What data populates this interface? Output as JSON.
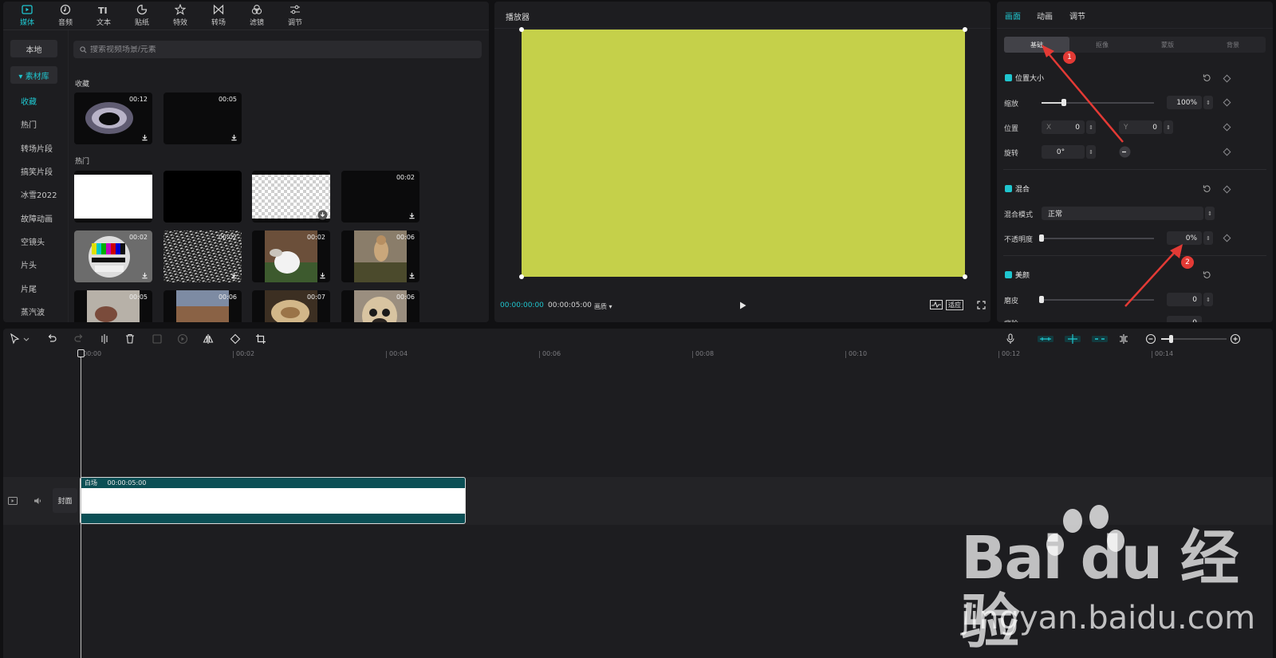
{
  "media_panel": {
    "tabs": [
      {
        "label": "媒体",
        "icon": "media-icon"
      },
      {
        "label": "音频",
        "icon": "audio-icon"
      },
      {
        "label": "文本",
        "icon": "text-icon"
      },
      {
        "label": "贴纸",
        "icon": "sticker-icon"
      },
      {
        "label": "特效",
        "icon": "effects-icon"
      },
      {
        "label": "转场",
        "icon": "transition-icon"
      },
      {
        "label": "滤镜",
        "icon": "filter-icon"
      },
      {
        "label": "调节",
        "icon": "adjust-icon"
      }
    ],
    "sidebar": {
      "local": "本地",
      "library": "▾ 素材库",
      "items": [
        "收藏",
        "热门",
        "转场片段",
        "搞笑片段",
        "冰雪2022",
        "故障动画",
        "空镜头",
        "片头",
        "片尾",
        "蒸汽波"
      ]
    },
    "search_placeholder": "搜索视频场景/元素",
    "sections": {
      "favorites": "收藏",
      "hot": "热门"
    },
    "favorites": [
      {
        "duration": "00:12"
      },
      {
        "duration": "00:05"
      }
    ],
    "hot_row1": [
      {
        "duration": ""
      },
      {
        "duration": ""
      },
      {
        "duration": ""
      },
      {
        "duration": "00:02"
      }
    ],
    "hot_row2": [
      {
        "duration": "00:02"
      },
      {
        "duration": "00:02"
      },
      {
        "duration": "00:02"
      },
      {
        "duration": "00:06"
      }
    ],
    "hot_row3": [
      {
        "duration": "00:05"
      },
      {
        "duration": "00:06"
      },
      {
        "duration": "00:07"
      },
      {
        "duration": "00:06"
      }
    ]
  },
  "player": {
    "title": "播放器",
    "current_time": "00:00:00:00",
    "total_time": "00:00:05:00",
    "quality": "画质 ▾",
    "fit": "适应",
    "canvas_color": "#c5d04a"
  },
  "properties": {
    "tabs": [
      "画面",
      "动画",
      "调节"
    ],
    "subtabs": [
      "基础",
      "抠像",
      "蒙版",
      "背景"
    ],
    "position_size": {
      "title": "位置大小",
      "scale_label": "缩放",
      "scale_value": "100%",
      "scale_fraction": 0.2,
      "position_label": "位置",
      "x_label": "X",
      "x_value": "0",
      "y_label": "Y",
      "y_value": "0",
      "rotation_label": "旋转",
      "rotation_value": "0°"
    },
    "blend": {
      "title": "混合",
      "mode_label": "混合模式",
      "mode_value": "正常",
      "opacity_label": "不透明度",
      "opacity_value": "0%",
      "opacity_fraction": 0
    },
    "beauty": {
      "title": "美颜",
      "smooth_label": "磨皮",
      "smooth_value": "0",
      "whiten_label": "瘦脸",
      "whiten_value": "0"
    }
  },
  "annotations": {
    "badge1": "1",
    "badge2": "2",
    "color": "#e33a35"
  },
  "timeline": {
    "ruler": [
      "00:00",
      "00:02",
      "00:04",
      "00:06",
      "00:08",
      "00:10",
      "00:12",
      "00:14"
    ],
    "clip": {
      "name": "白场",
      "duration": "00:00:05:00"
    },
    "cover_label": "封面"
  },
  "watermark": {
    "brand": "Bai du 经验",
    "url": "jingyan.baidu.com"
  },
  "colors": {
    "accent": "#1fc6cf",
    "clip_header": "#0b4f55",
    "panel": "#1d1d20"
  }
}
